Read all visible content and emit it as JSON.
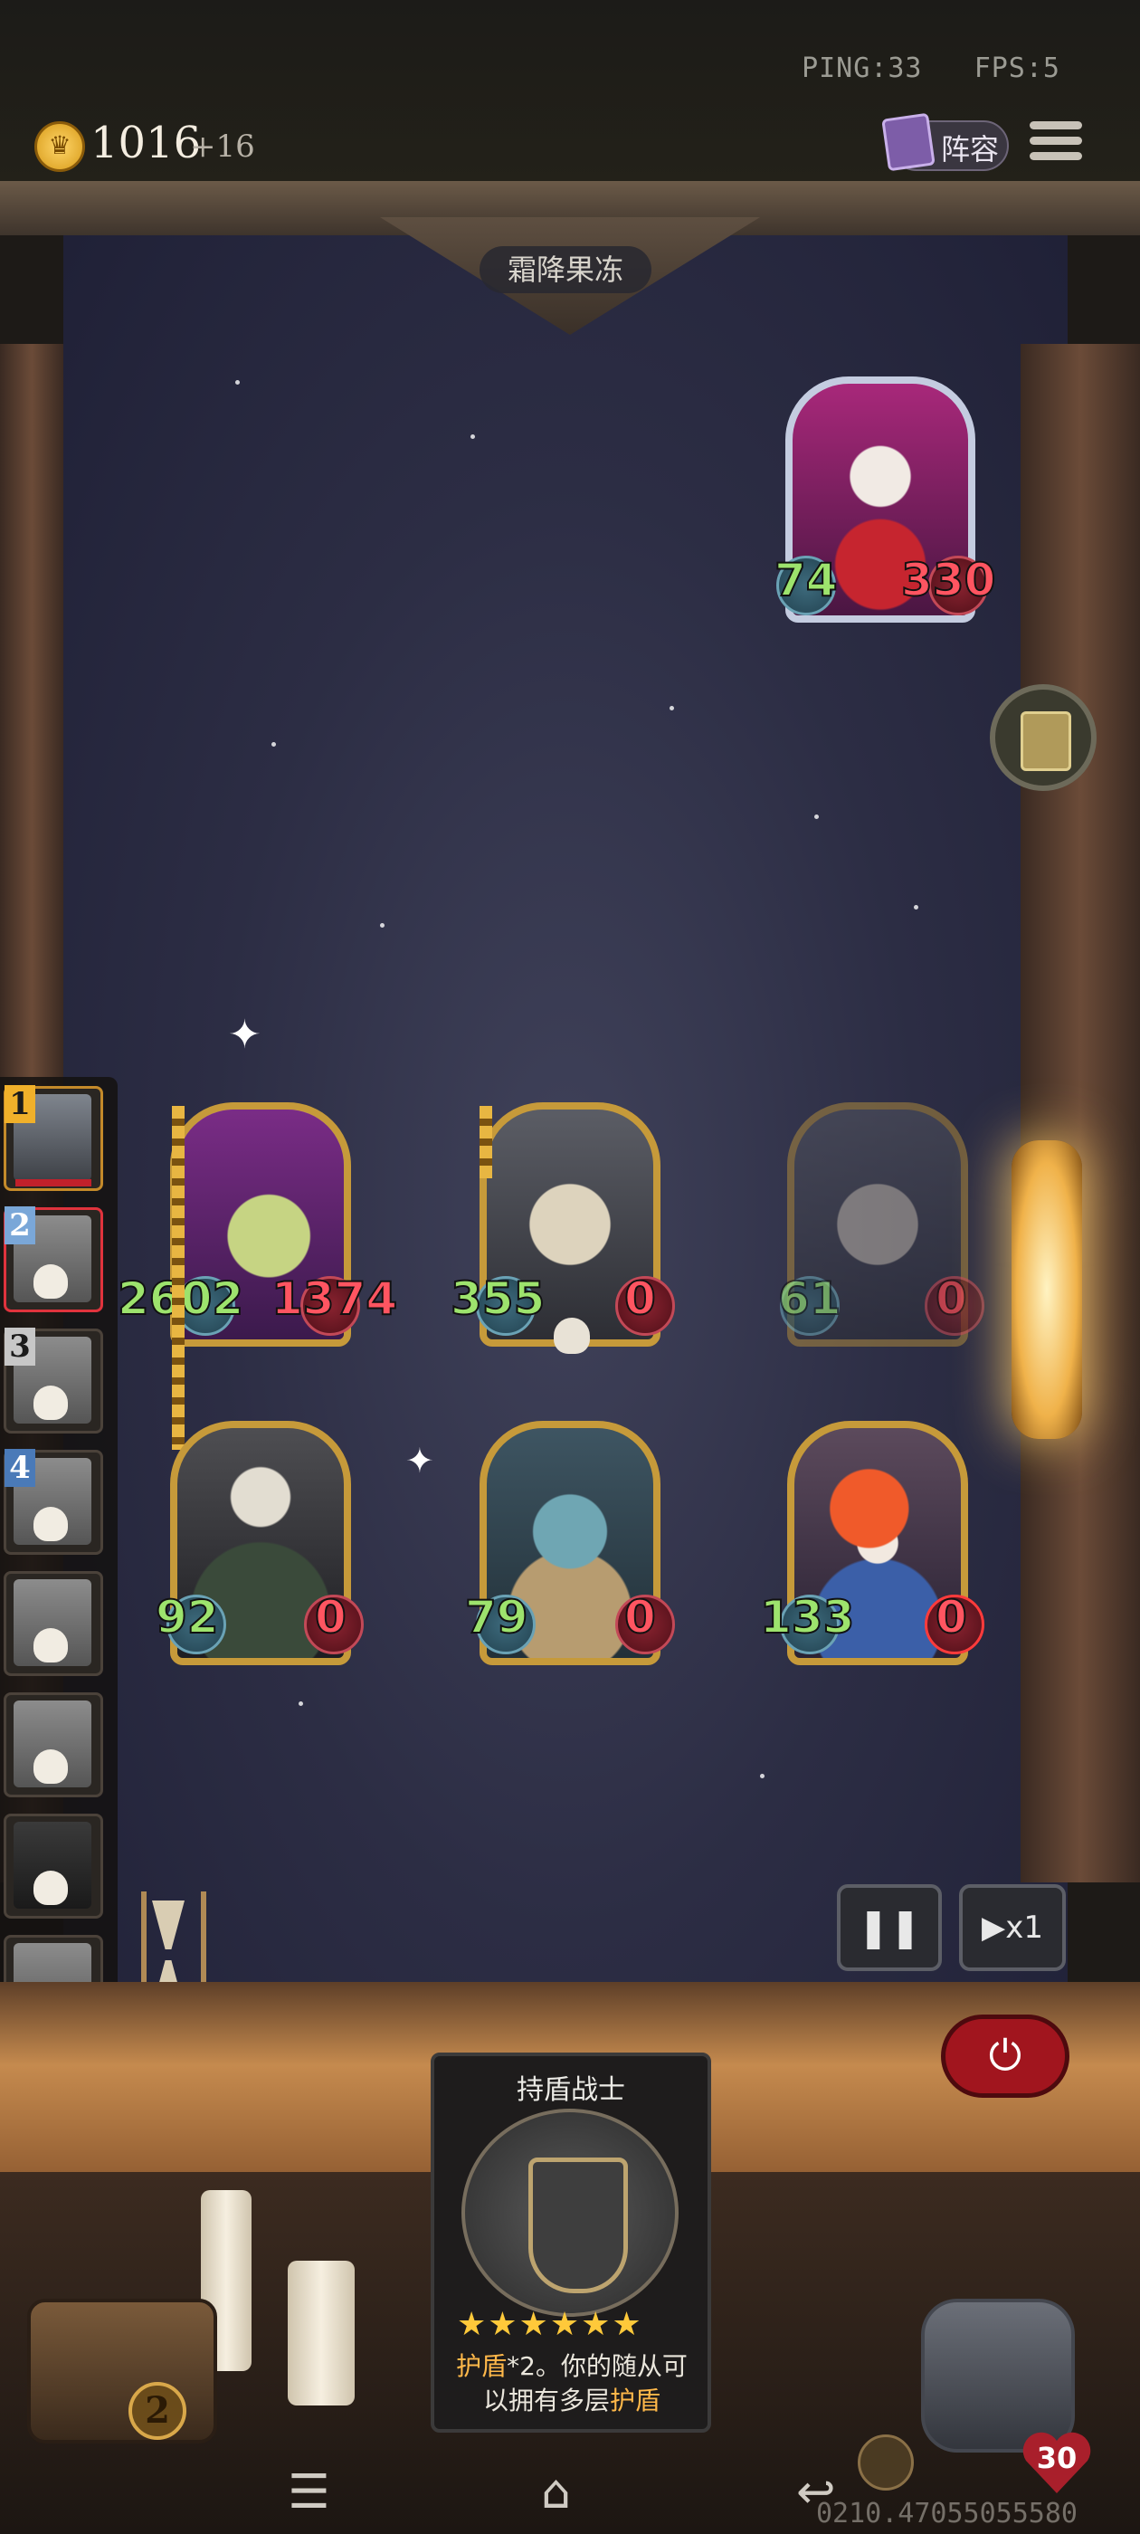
{
  "status": {
    "ping_label": "PING:33",
    "fps_label": "FPS:5"
  },
  "gold": {
    "amount": "1016",
    "income": "+16"
  },
  "header": {
    "lineup_label": "阵容",
    "stage_name": "霜降果冻"
  },
  "enemy": {
    "name": "clown-boss",
    "attack": "74",
    "health": "330"
  },
  "board_units": [
    {
      "slot": "front-left",
      "attack": "2602",
      "health": "1374"
    },
    {
      "slot": "front-middle",
      "attack": "355",
      "health": "0"
    },
    {
      "slot": "front-right",
      "attack": "61",
      "health": "0"
    },
    {
      "slot": "back-left",
      "attack": "92",
      "health": "0"
    },
    {
      "slot": "back-middle",
      "attack": "79",
      "health": "0"
    },
    {
      "slot": "back-right",
      "attack": "133",
      "health": "0"
    }
  ],
  "sidebar": [
    "1",
    "2",
    "3",
    "4"
  ],
  "selected_card": {
    "name": "持盾战士",
    "stars": "★★★★★★",
    "desc_part1": "护盾",
    "desc_part2": "*2。你的随从可以拥有多层",
    "desc_part3": "护盾"
  },
  "controls": {
    "pause_icon": "pause-icon",
    "speed_label": "▶x1",
    "power_icon": "power-icon"
  },
  "chest": {
    "level": "2"
  },
  "hero": {
    "health": "30"
  },
  "build_id": "0210.47055055580"
}
